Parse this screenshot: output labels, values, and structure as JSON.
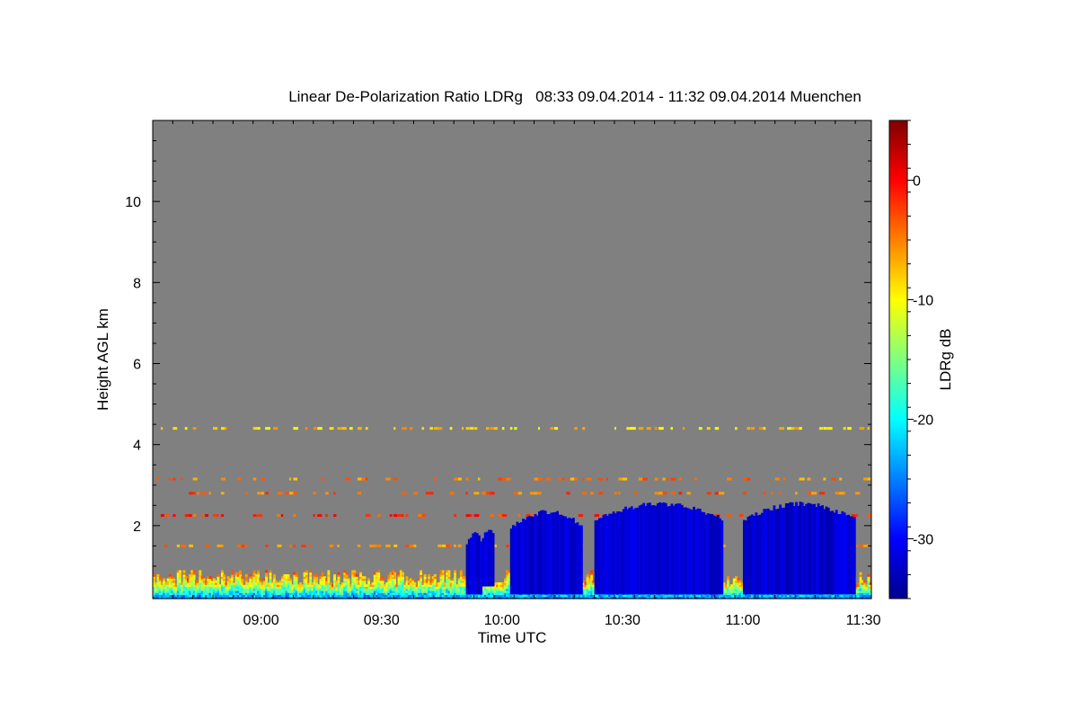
{
  "chart_data": {
    "type": "heatmap",
    "title": "Linear De-Polarization Ratio LDRg   08:33 09.04.2014 - 11:32 09.04.2014 Muenchen",
    "xlabel": "Time UTC",
    "ylabel": "Height AGL km",
    "colorbar_label": "LDRg dB",
    "x_range": [
      "08:33",
      "11:32"
    ],
    "x_ticks": [
      "09:00",
      "09:30",
      "10:00",
      "10:30",
      "11:00",
      "11:30"
    ],
    "y_ticks": [
      2,
      4,
      6,
      8,
      10
    ],
    "ylim": [
      0.2,
      12
    ],
    "colorbar_ticks": [
      0,
      -10,
      -20,
      -30
    ],
    "colorbar_range": [
      -35,
      5
    ],
    "background": "no-signal (grey)",
    "features": [
      {
        "name": "near-surface aerosol layer",
        "t_start": "08:33",
        "t_end": "11:32",
        "h_bottom": 0.2,
        "h_top": 0.9,
        "ldr_db_range": [
          -25,
          -5
        ]
      },
      {
        "name": "cloud cell",
        "t_start": "09:51",
        "t_end": "09:55",
        "h_bottom": 0.3,
        "h_top": 1.9,
        "ldr_db": -32
      },
      {
        "name": "cloud cell",
        "t_start": "09:55",
        "t_end": "09:58",
        "h_bottom": 0.5,
        "h_top": 2.0,
        "ldr_db": -32
      },
      {
        "name": "cloud cell",
        "t_start": "10:02",
        "t_end": "10:20",
        "h_bottom": 0.3,
        "h_top": 2.4,
        "ldr_db": -32
      },
      {
        "name": "cloud cell",
        "t_start": "10:23",
        "t_end": "10:55",
        "h_bottom": 0.3,
        "h_top": 2.6,
        "ldr_db": -32
      },
      {
        "name": "cloud cell",
        "t_start": "11:00",
        "t_end": "11:28",
        "h_bottom": 0.3,
        "h_top": 2.6,
        "ldr_db": -32
      },
      {
        "name": "elevated aerosol streak",
        "height": 4.4,
        "ldr_db": -8
      },
      {
        "name": "elevated aerosol streak",
        "height": 3.15,
        "ldr_db": -5
      },
      {
        "name": "elevated aerosol streak",
        "height": 2.8,
        "ldr_db": -4
      },
      {
        "name": "elevated aerosol streak",
        "height": 2.25,
        "ldr_db": -2
      },
      {
        "name": "elevated aerosol streak",
        "height": 1.5,
        "ldr_db": -5
      }
    ]
  },
  "colors": {
    "no_signal": "#808080",
    "colormap": [
      "#00008f",
      "#0000ff",
      "#0080ff",
      "#00ffff",
      "#80ff80",
      "#ffff00",
      "#ff8000",
      "#ff0000",
      "#800000"
    ]
  }
}
